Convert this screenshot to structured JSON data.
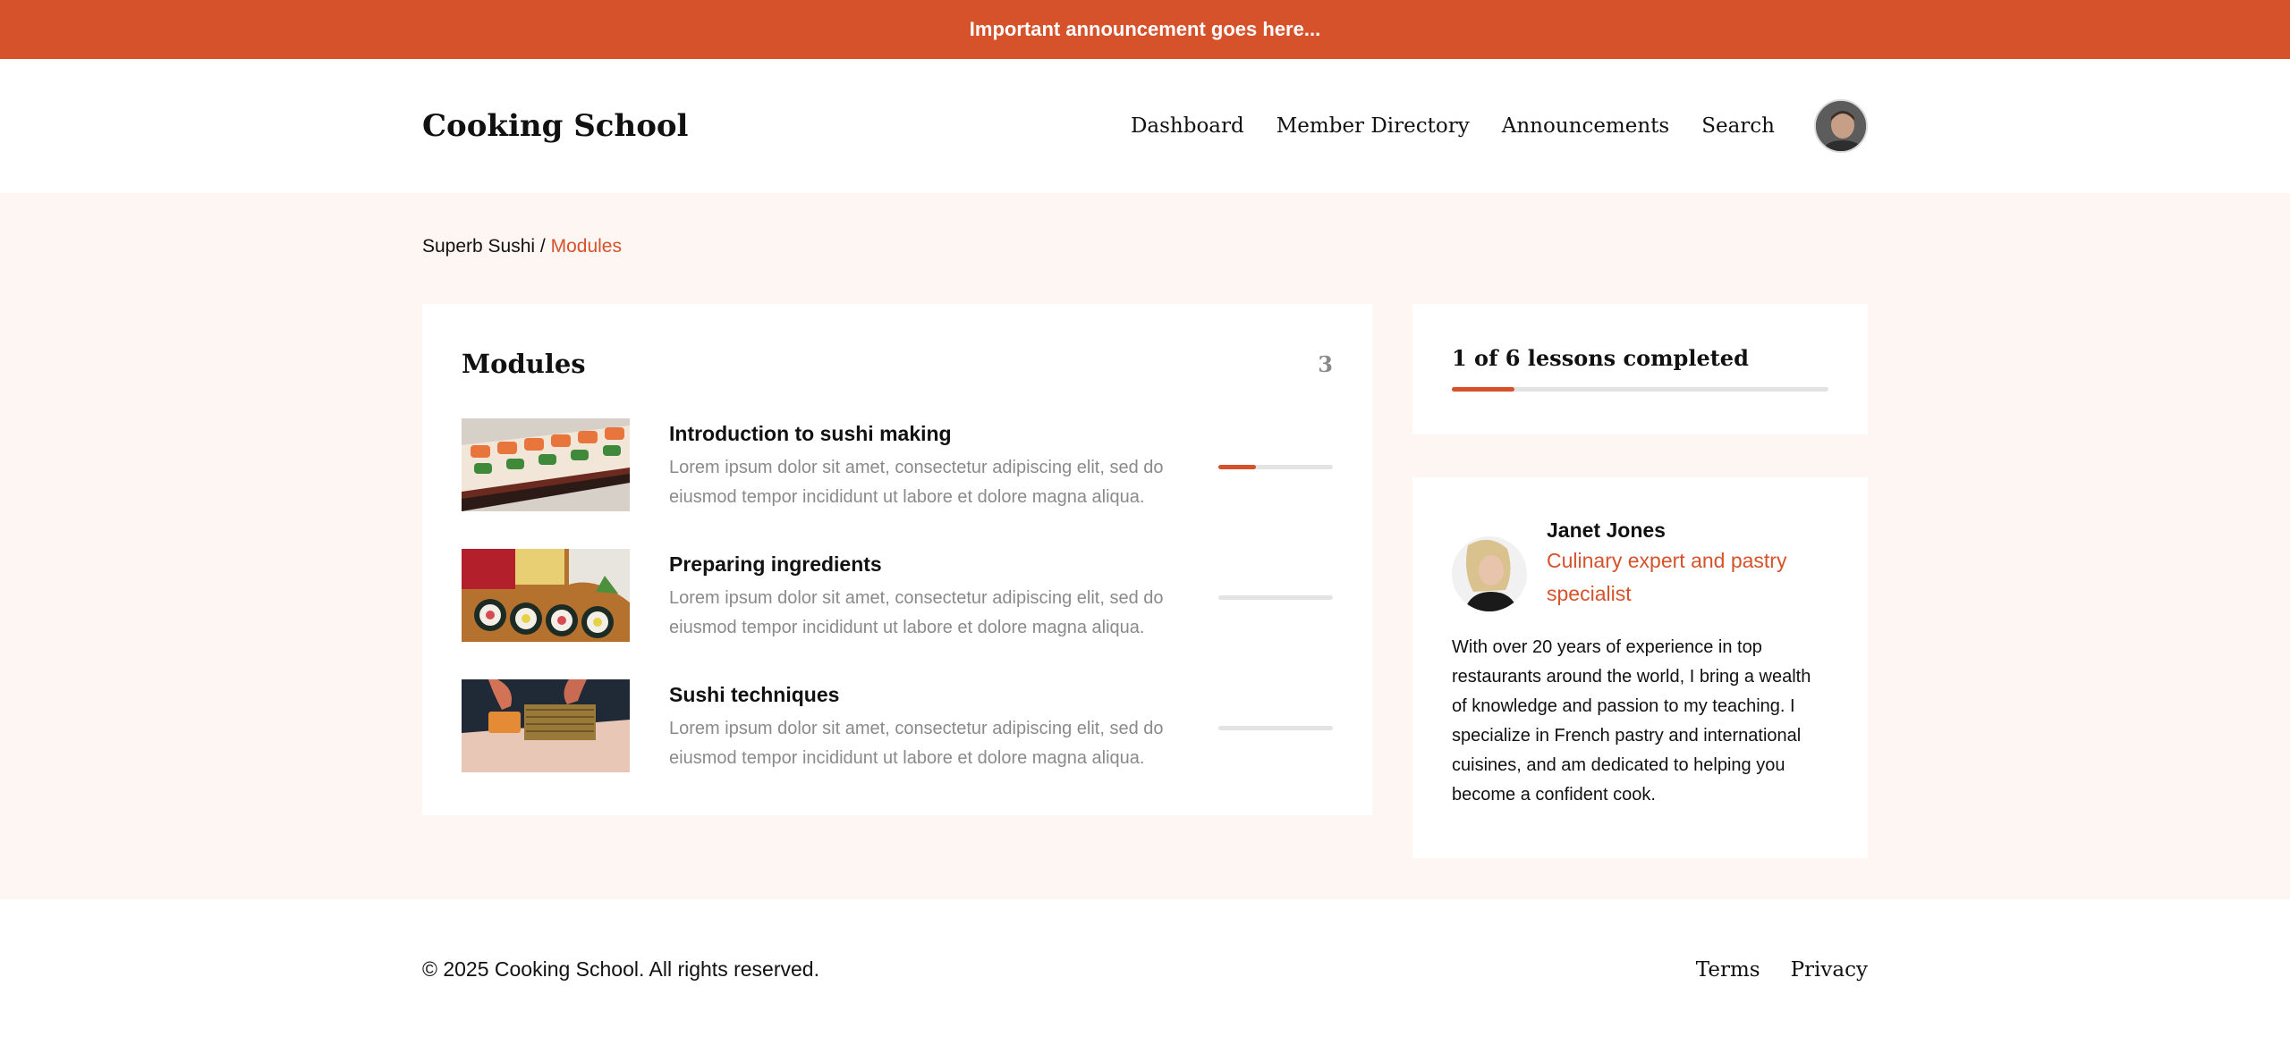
{
  "announcement": "Important announcement goes here...",
  "header": {
    "brand": "Cooking School",
    "nav": [
      "Dashboard",
      "Member Directory",
      "Announcements",
      "Search"
    ]
  },
  "breadcrumb": {
    "parent": "Superb Sushi",
    "separator": " / ",
    "current": "Modules"
  },
  "modules": {
    "title": "Modules",
    "count": "3",
    "items": [
      {
        "title": "Introduction to sushi making",
        "description": "Lorem ipsum dolor sit amet, consectetur adipiscing elit, sed do eiusmod tempor incididunt ut labore et dolore magna aliqua.",
        "progress": 0.33
      },
      {
        "title": "Preparing ingredients",
        "description": "Lorem ipsum dolor sit amet, consectetur adipiscing elit, sed do eiusmod tempor incididunt ut labore et dolore magna aliqua.",
        "progress": 0
      },
      {
        "title": "Sushi techniques",
        "description": "Lorem ipsum dolor sit amet, consectetur adipiscing elit, sed do eiusmod tempor incididunt ut labore et dolore magna aliqua.",
        "progress": 0
      }
    ]
  },
  "progress": {
    "label": "1 of 6 lessons completed",
    "completed": 1,
    "total": 6
  },
  "instructor": {
    "name": "Janet Jones",
    "role": "Culinary expert and pastry specialist",
    "bio": "With over 20 years of experience in top restaurants around the world, I bring a wealth of knowledge and passion to my teaching. I specialize in French pastry and international cuisines, and am dedicated to helping you become a confident cook."
  },
  "footer": {
    "copyright": "© 2025 Cooking School. All rights reserved.",
    "links": [
      "Terms",
      "Privacy"
    ]
  },
  "colors": {
    "accent": "#d6522b",
    "page_background": "#fdf6f3",
    "muted_text": "#8a8a8a",
    "track": "#e3e3e3"
  },
  "icons": {
    "avatar": "user-avatar"
  }
}
